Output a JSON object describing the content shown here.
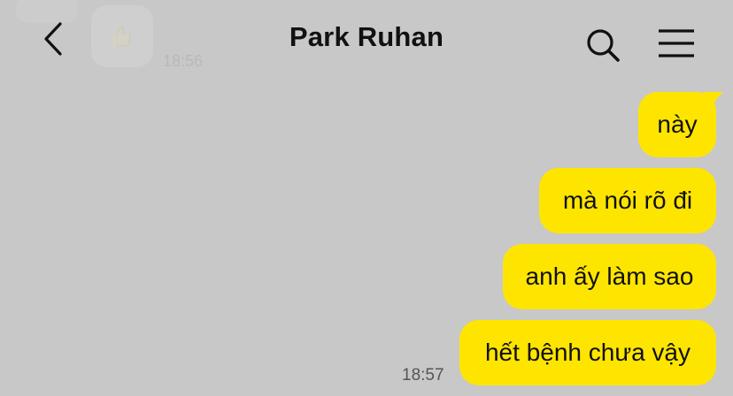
{
  "header": {
    "title": "Park Ruhan",
    "back_icon": "chevron-left-icon",
    "search_icon": "search-icon",
    "menu_icon": "hamburger-menu-icon"
  },
  "background_message": {
    "time": "18:56",
    "icon": "thumbs-up-icon"
  },
  "messages": [
    {
      "text": "này"
    },
    {
      "text": "mà nói rõ đi"
    },
    {
      "text": "anh ấy làm sao"
    },
    {
      "text": "hết bệnh chưa vậy"
    }
  ],
  "last_time": "18:57",
  "colors": {
    "background": "#c8c8c8",
    "bubble": "#fee500",
    "text": "#111111"
  }
}
